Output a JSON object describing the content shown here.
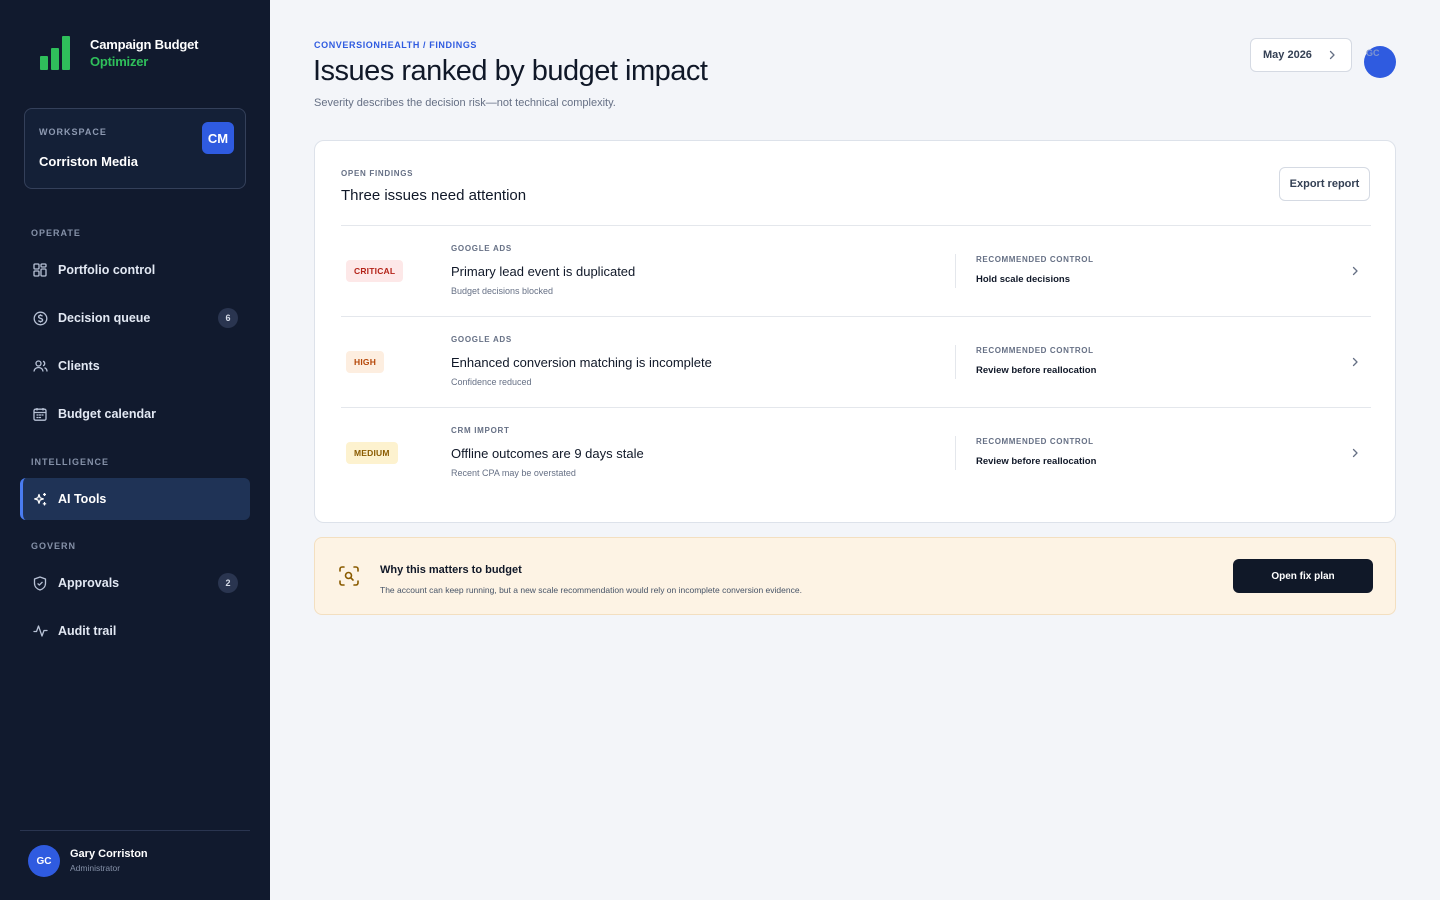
{
  "app": {
    "name_line1": "Campaign Budget",
    "name_line2": "Optimizer",
    "brand_color": "#2fbf5b"
  },
  "workspace": {
    "label": "WORKSPACE",
    "name": "Corriston Media",
    "badge": "CM"
  },
  "sidebar": {
    "sections": {
      "operate": "OPERATE",
      "intelligence": "INTELLIGENCE",
      "govern": "GOVERN"
    },
    "items": [
      {
        "label": "Portfolio control",
        "icon": "grid-icon"
      },
      {
        "label": "Decision queue",
        "icon": "dollar-circle-icon",
        "count": "6"
      },
      {
        "label": "Clients",
        "icon": "users-icon"
      },
      {
        "label": "Budget calendar",
        "icon": "calendar-icon"
      },
      {
        "label": "AI Tools",
        "icon": "sparkle-icon",
        "active": true
      },
      {
        "label": "Approvals",
        "icon": "shield-check-icon",
        "count": "2"
      },
      {
        "label": "Audit trail",
        "icon": "activity-icon"
      }
    ]
  },
  "user": {
    "initials": "GC",
    "name": "Gary Corriston",
    "role": "Administrator"
  },
  "header": {
    "breadcrumb": "CONVERSIONHEALTH / FINDINGS",
    "title": "Issues ranked by budget impact",
    "subtitle": "Severity describes the decision risk—not technical complexity.",
    "period": "May 2026",
    "avatar_initials": "GC"
  },
  "findings": {
    "eyebrow": "OPEN FINDINGS",
    "title": "Three issues need attention",
    "export_label": "Export report",
    "rows": [
      {
        "severity": "CRITICAL",
        "source": "GOOGLE ADS",
        "title": "Primary lead event is duplicated",
        "desc": "Budget decisions blocked",
        "control_label": "RECOMMENDED CONTROL",
        "control": "Hold scale decisions"
      },
      {
        "severity": "HIGH",
        "source": "GOOGLE ADS",
        "title": "Enhanced conversion matching is incomplete",
        "desc": "Confidence reduced",
        "control_label": "RECOMMENDED CONTROL",
        "control": "Review before reallocation"
      },
      {
        "severity": "MEDIUM",
        "source": "CRM IMPORT",
        "title": "Offline outcomes are 9 days stale",
        "desc": "Recent CPA may be overstated",
        "control_label": "RECOMMENDED CONTROL",
        "control": "Review before reallocation"
      }
    ]
  },
  "alert": {
    "title": "Why this matters to budget",
    "body": "The account can keep running, but a new scale recommendation would rely on incomplete conversion evidence.",
    "button": "Open fix plan"
  }
}
